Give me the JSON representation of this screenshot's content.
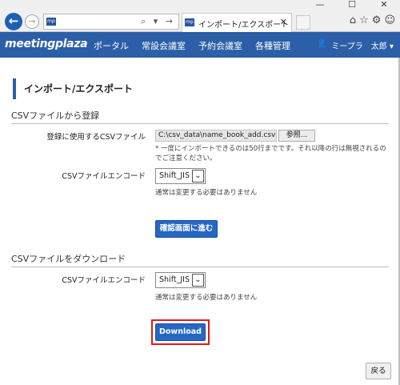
{
  "browser": {
    "address_value": "",
    "tab_title": "インポート/エクスポート",
    "win_minimize": "—",
    "win_maximize": "☐",
    "win_close": "✕",
    "favicon_text": "mp",
    "address_icons": "⌕ ▾ →",
    "tab_close": "✕",
    "back_glyph": "←",
    "forward_glyph": "→",
    "toolbar_icons": [
      "⌂",
      "☆",
      "⚙",
      "☺"
    ],
    "accent_color": "#1c5fb5"
  },
  "app": {
    "logo": "meetingplaza",
    "nav": [
      "ポータル",
      "常設会議室",
      "予約会議室",
      "各種管理"
    ],
    "user_name": "ミープラ　太郎 ▾",
    "user_icon": "👤",
    "header_color": "#2d5fa8"
  },
  "page": {
    "title": "インポート/エクスポート",
    "import_section": {
      "heading": "CSVファイルから登録",
      "file_label": "登録に使用するCSVファイル",
      "file_value": "C:\\csv_data\\name_book_add.csv",
      "browse_label": "参照...",
      "file_note": "* 一度にインポートできるのは50行までです。それ以降の行は無視されるのでご注意ください。",
      "encode_label": "CSVファイルエンコード",
      "encode_value": "Shift_JIS",
      "encode_note": "通常は変更する必要はありません",
      "confirm_button": "確認画面に進む"
    },
    "download_section": {
      "heading": "CSVファイルをダウンロード",
      "encode_label": "CSVファイルエンコード",
      "encode_value": "Shift_JIS",
      "encode_note": "通常は変更する必要はありません",
      "download_button": "Download"
    },
    "back_button": "戻る"
  }
}
